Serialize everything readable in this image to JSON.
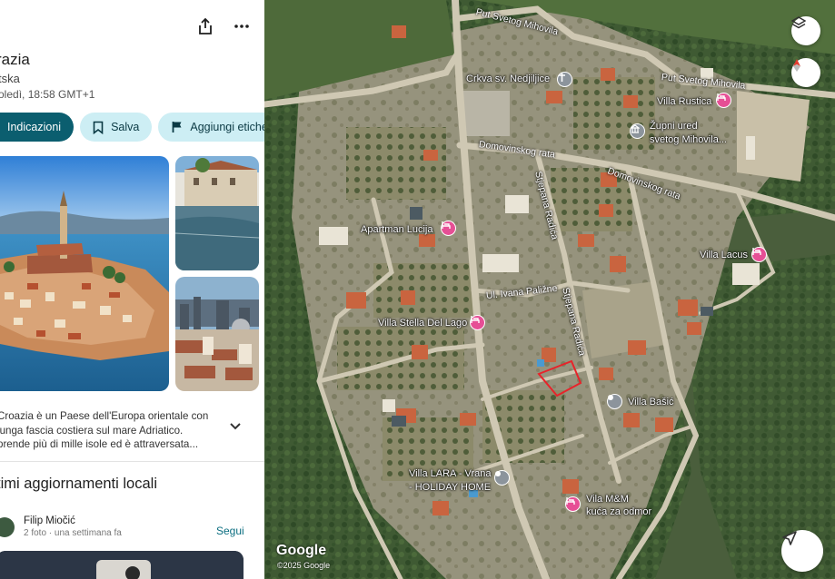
{
  "panel": {
    "title": "razia",
    "subtitle": "tska",
    "local_time": "oledì, 18:58 GMT+1",
    "share_icon": "share-icon",
    "more_icon": "more-vert-icon",
    "buttons": {
      "directions": "Indicazioni",
      "save": "Salva",
      "add_label": "Aggiungi etichet"
    },
    "description": "Croazia è un Paese dell'Europa orientale con lunga fascia costiera sul mare Adriatico. prende più di mille isole ed è attraversata...",
    "updates_title": "timi aggiornamenti locali",
    "post": {
      "author": "Filip Miočić",
      "info": "2 foto · una settimana fa",
      "follow": "Segui"
    }
  },
  "map": {
    "attribution_logo": "Google",
    "copyright": "©2025 Google",
    "road_labels": {
      "mihovila_top": "Put Svetog Mihovila",
      "mihovila_right": "Put Svetog Mihovila",
      "domovinskog_left": "Domovinskog rata",
      "domovinskog_right": "Domovinskog rata",
      "radica_top": "Stjepana Radića",
      "radica_bottom": "Stjepana Radića",
      "palizne": "Ul. Ivana Paližne"
    },
    "places": {
      "church": "Crkva sv. Nedjiljice",
      "villa_rustica": "Villa Rustica",
      "zupni_ured_1": "Župni ured",
      "zupni_ured_2": "svetog Mihovila...",
      "apartman_lucija": "Apartman Lucija",
      "villa_lacus": "Villa Lacus",
      "villa_stella": "Villa Stella Del Lago",
      "villa_basic": "Villa Bašić",
      "villa_lara_1": "Villa LARA - Vrana",
      "villa_lara_2": "- HOLIDAY HOME",
      "vila_mm_1": "Vila M&M",
      "vila_mm_2": "kuća za odmor"
    },
    "controls": {
      "layers": "layers-icon",
      "compass": "compass-icon",
      "directions": "navigation-icon"
    },
    "colors": {
      "pin_lodging": "#e64f95",
      "pin_generic": "#8c949c",
      "selection_outline": "#e8232a"
    }
  }
}
